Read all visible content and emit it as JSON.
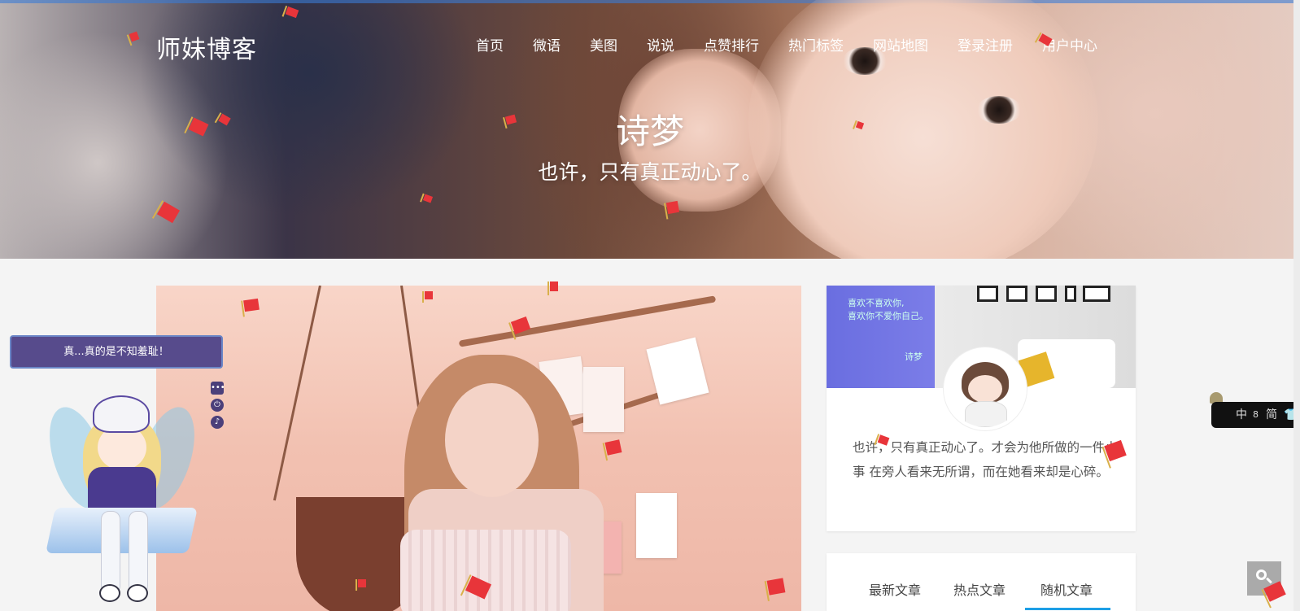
{
  "header": {
    "logo": "师妹博客",
    "nav": [
      "首页",
      "微语",
      "美图",
      "说说",
      "点赞排行",
      "热门标签",
      "网站地图",
      "登录注册",
      "用户中心"
    ]
  },
  "hero": {
    "title": "诗梦",
    "subtitle": "也许，只有真正动心了。"
  },
  "profile": {
    "banner_text": [
      "喜欢不喜欢你,",
      "喜欢你不爱你自己。",
      "诗梦"
    ],
    "bio": "也许，只有真正动心了。才会为他所做的一件小事 在旁人看来无所谓，而在她看来却是心碎。"
  },
  "tabs": {
    "items": [
      "最新文章",
      "热点文章",
      "随机文章"
    ],
    "active": "随机文章"
  },
  "mascot": {
    "speech": "真...真的是不知羞耻！",
    "tools": [
      "chat-icon",
      "power-icon",
      "music-icon"
    ]
  },
  "language_widget": {
    "items": [
      "中",
      "简"
    ]
  },
  "colors": {
    "tab_active_underline": "#1e9fe6",
    "speech_bg": "#574b8c",
    "flag_red": "#e8353a"
  }
}
